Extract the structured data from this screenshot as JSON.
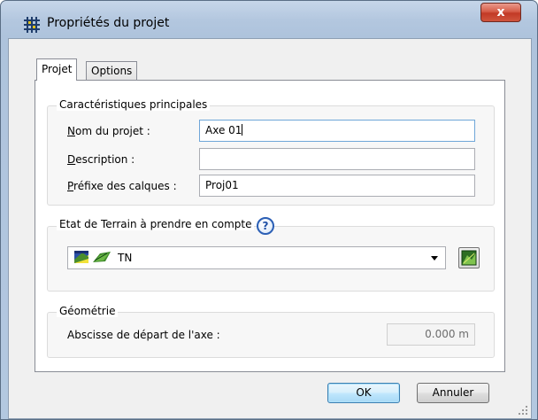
{
  "window": {
    "title": "Propriétés du projet",
    "close_label": "x"
  },
  "tabs": [
    {
      "label": "Projet",
      "active": true
    },
    {
      "label": "Options",
      "active": false
    }
  ],
  "main_group": {
    "title": "Caractéristiques principales",
    "fields": [
      {
        "label_underline": "N",
        "label_rest": "om du projet :",
        "value": "Axe 01"
      },
      {
        "label_underline": "D",
        "label_rest": "escription :",
        "value": ""
      },
      {
        "label_underline": "P",
        "label_rest": "réfixe des calques :",
        "value": "Proj01"
      }
    ]
  },
  "terrain_group": {
    "title": "Etat de Terrain à prendre en compte",
    "help_glyph": "?",
    "selected": "TN"
  },
  "geometry_group": {
    "title": "Géométrie",
    "label": "Abscisse de départ de l'axe :",
    "value": "0.000 m"
  },
  "buttons": {
    "ok": "OK",
    "cancel": "Annuler"
  },
  "colors": {
    "title_bar": "#b3c7df",
    "close_button": "#c23a26",
    "help_icon": "#2b5fb5"
  }
}
